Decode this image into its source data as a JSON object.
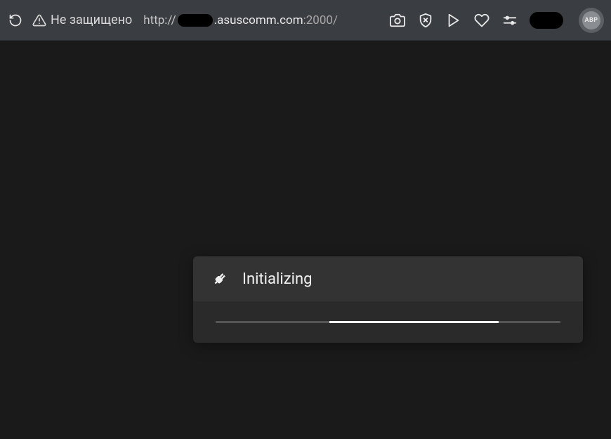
{
  "browser": {
    "security_label": "Не защищено",
    "url": {
      "protocol": "http://",
      "domain_visible": ".asuscomm.com",
      "port": ":2000/"
    },
    "extension_badge": "ABP"
  },
  "modal": {
    "title": "Initializing",
    "progress": {
      "offset_percent": 33,
      "width_percent": 49
    }
  }
}
